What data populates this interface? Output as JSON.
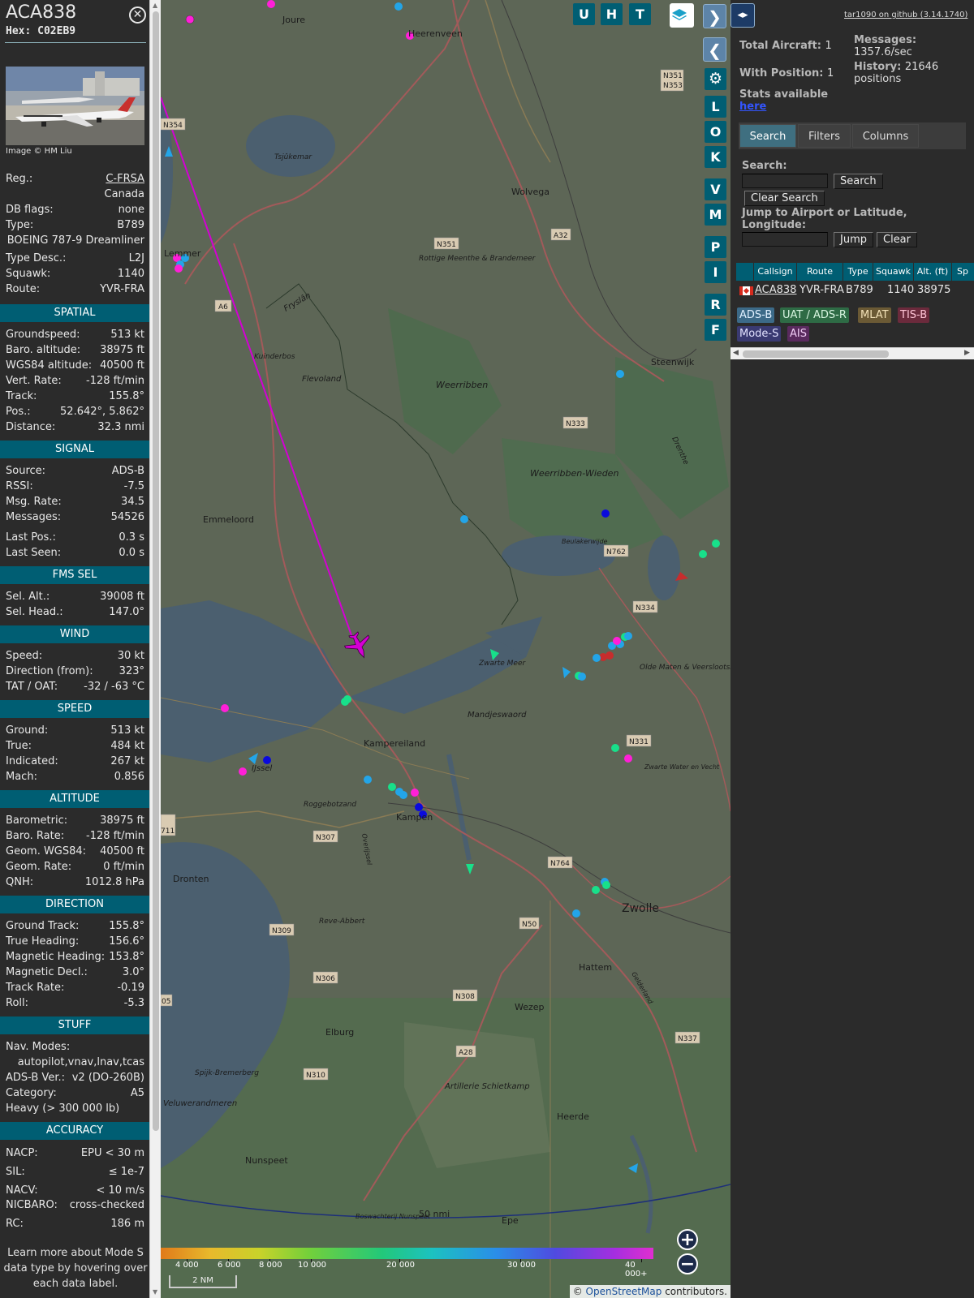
{
  "aircraft": {
    "callsign": "ACA838",
    "hex_label": "Hex:",
    "hex": "C02EB9",
    "photo_credit": "Image © HM Liu",
    "close_icon": "close-icon"
  },
  "info_rows": {
    "reg": {
      "k": "Reg.:",
      "v": "C-FRSA"
    },
    "country": {
      "v": "Canada"
    },
    "dbflags": {
      "k": "DB flags:",
      "v": "none"
    },
    "type": {
      "k": "Type:",
      "v": "B789"
    },
    "type_name": {
      "v": "BOEING 787-9 Dreamliner"
    },
    "type_desc": {
      "k": "Type Desc.:",
      "v": "L2J"
    },
    "squawk": {
      "k": "Squawk:",
      "v": "1140"
    },
    "route": {
      "k": "Route:",
      "v": "YVR-FRA"
    }
  },
  "sections": [
    {
      "title": "SPATIAL",
      "rows": [
        {
          "k": "Groundspeed:",
          "v": "513 kt"
        },
        {
          "k": "Baro. altitude:",
          "v": "38975 ft"
        },
        {
          "k": "WGS84 altitude:",
          "v": "40500 ft"
        },
        {
          "k": "Vert. Rate:",
          "v": "-128 ft/min"
        },
        {
          "k": "Track:",
          "v": "155.8°"
        },
        {
          "k": "Pos.:",
          "v": "52.642°, 5.862°"
        },
        {
          "k": "Distance:",
          "v": "32.3 nmi"
        }
      ]
    },
    {
      "title": "SIGNAL",
      "rows": [
        {
          "k": "Source:",
          "v": "ADS-B"
        },
        {
          "k": "RSSI:",
          "v": "-7.5"
        },
        {
          "k": "Msg. Rate:",
          "v": "34.5"
        },
        {
          "k": "Messages:",
          "v": "54526"
        },
        {
          "k": "Last Pos.:",
          "v": "0.3 s"
        },
        {
          "k": "Last Seen:",
          "v": "0.0 s"
        }
      ]
    },
    {
      "title": "FMS SEL",
      "rows": [
        {
          "k": "Sel. Alt.:",
          "v": "39008 ft"
        },
        {
          "k": "Sel. Head.:",
          "v": "147.0°"
        }
      ]
    },
    {
      "title": "WIND",
      "rows": [
        {
          "k": "Speed:",
          "v": "30 kt"
        },
        {
          "k": "Direction (from):",
          "v": "323°"
        },
        {
          "k": "TAT / OAT:",
          "v": "-32 / -63 °C"
        }
      ]
    },
    {
      "title": "SPEED",
      "rows": [
        {
          "k": "Ground:",
          "v": "513 kt"
        },
        {
          "k": "True:",
          "v": "484 kt"
        },
        {
          "k": "Indicated:",
          "v": "267 kt"
        },
        {
          "k": "Mach:",
          "v": "0.856"
        }
      ]
    },
    {
      "title": "ALTITUDE",
      "rows": [
        {
          "k": "Barometric:",
          "v": "38975 ft"
        },
        {
          "k": "Baro. Rate:",
          "v": "-128 ft/min"
        },
        {
          "k": "Geom. WGS84:",
          "v": "40500 ft"
        },
        {
          "k": "Geom. Rate:",
          "v": "0 ft/min"
        },
        {
          "k": "QNH:",
          "v": "1012.8 hPa"
        }
      ]
    },
    {
      "title": "DIRECTION",
      "rows": [
        {
          "k": "Ground Track:",
          "v": "155.8°"
        },
        {
          "k": "True Heading:",
          "v": "156.6°"
        },
        {
          "k": "Magnetic Heading:",
          "v": "153.8°"
        },
        {
          "k": "Magnetic Decl.:",
          "v": "3.0°"
        },
        {
          "k": "Track Rate:",
          "v": "-0.19"
        },
        {
          "k": "Roll:",
          "v": "-5.3"
        }
      ]
    },
    {
      "title": "STUFF",
      "rows": [
        {
          "k": "Nav. Modes:",
          "v": ""
        },
        {
          "k": "",
          "v": "autopilot,vnav,lnav,tcas"
        },
        {
          "k": "ADS-B Ver.:",
          "v": "v2 (DO-260B)"
        },
        {
          "k": "Category:",
          "v": "A5"
        },
        {
          "k": "Heavy (> 300 000 lb)",
          "v": ""
        }
      ]
    },
    {
      "title": "ACCURACY",
      "rows": [
        {
          "k": "NACP:",
          "v": "EPU < 30 m"
        },
        {
          "k": "SIL:",
          "v": "≤ 1e-7"
        },
        {
          "k": "NACV:",
          "v": "< 10 m/s"
        },
        {
          "k": "NICBARO:",
          "v": "cross-checked"
        },
        {
          "k": "RC:",
          "v": "186 m"
        }
      ]
    }
  ],
  "footer_note": "Learn more about Mode S data type by hovering over each data label.",
  "map": {
    "buttons": [
      "U",
      "H",
      "T"
    ],
    "side_buttons": [
      "L",
      "O",
      "K",
      "V",
      "M",
      "P",
      "I",
      "R",
      "F"
    ],
    "places": [
      {
        "name": "Joure"
      },
      {
        "name": "Heerenveen"
      },
      {
        "name": "Wolvega"
      },
      {
        "name": "Lemmer"
      },
      {
        "name": "Tsjûkemar"
      },
      {
        "name": "Rottige Meenthe & Brandemeer"
      },
      {
        "name": "Fryslân"
      },
      {
        "name": "Kuinderbos"
      },
      {
        "name": "Flevoland"
      },
      {
        "name": "Weerribben"
      },
      {
        "name": "Steenwijk"
      },
      {
        "name": "Weerribben-Wieden"
      },
      {
        "name": "Emmeloord"
      },
      {
        "name": "Beulakerwijde"
      },
      {
        "name": "Drenthe"
      },
      {
        "name": "Zwarte Meer"
      },
      {
        "name": "Olde Maten & Veerslootslanden"
      },
      {
        "name": "Mandjeswaord"
      },
      {
        "name": "Kampereiland"
      },
      {
        "name": "Kampen"
      },
      {
        "name": "Dronten"
      },
      {
        "name": "Roggebotzand"
      },
      {
        "name": "Zwolle"
      },
      {
        "name": "Reve-Abbert"
      },
      {
        "name": "Hattem"
      },
      {
        "name": "Wezep"
      },
      {
        "name": "Elburg"
      },
      {
        "name": "Artillerie Schietkamp"
      },
      {
        "name": "Heerde"
      },
      {
        "name": "Spijk-Bremerberg"
      },
      {
        "name": "Veluwerandmeren"
      },
      {
        "name": "Nunspeet"
      },
      {
        "name": "Epe"
      },
      {
        "name": "Boswachterij Nunspeet"
      },
      {
        "name": "IJssel"
      },
      {
        "name": "Overijssel"
      },
      {
        "name": "Gelderland"
      },
      {
        "name": "Zwarte Water en Vecht"
      }
    ],
    "roads": [
      "N354",
      "N351",
      "N353",
      "A6",
      "A32",
      "N351",
      "N333",
      "N762",
      "N334",
      "N331",
      "N307",
      "N764",
      "N309",
      "N50",
      "N306",
      "N308",
      "A28",
      "N310",
      "N337",
      "711",
      "05"
    ],
    "range_ring_label": "50 nmi",
    "scale_label": "2 NM",
    "altitude_scale": [
      "4 000",
      "6 000",
      "8 000",
      "10 000",
      "20 000",
      "30 000",
      "40 000+"
    ],
    "attribution_prefix": "© ",
    "attribution_link": "OpenStreetMap",
    "attribution_suffix": " contributors.",
    "zoom_in": "+",
    "zoom_out": "−"
  },
  "right_panel": {
    "toggle_icon": "expand-icon",
    "github_link": "tar1090 on github (3.14.1740)",
    "total_aircraft_label": "Total Aircraft:",
    "total_aircraft": "1",
    "with_position_label": "With Position:",
    "with_position": "1",
    "messages_label": "Messages:",
    "messages_rate": "1357.6/sec",
    "history_label": "History:",
    "history_value": "21646 positions",
    "stats_label": "Stats available",
    "stats_link": "here",
    "tabs": [
      "Search",
      "Filters",
      "Columns"
    ],
    "search_label": "Search:",
    "search_button": "Search",
    "clear_search_button": "Clear Search",
    "jump_label": "Jump to Airport or Latitude, Longitude:",
    "jump_button": "Jump",
    "clear_button": "Clear",
    "table": {
      "headers": [
        "Callsign",
        "Route",
        "Type",
        "Squawk",
        "Alt. (ft)",
        "Sp"
      ],
      "rows": [
        {
          "callsign": "ACA838",
          "route": "YVR-FRA",
          "type": "B789",
          "squawk": "1140",
          "alt": "38975"
        }
      ]
    },
    "source_chips": [
      {
        "label": "ADS-B",
        "color": "#3c6a88",
        "text": "#e0f0ff"
      },
      {
        "label": "UAT / ADS-R",
        "color": "#2e6b45",
        "text": "#d8f5e0"
      },
      {
        "label": "MLAT",
        "color": "#6b5a35",
        "text": "#f3e2b8"
      },
      {
        "label": "TIS-B",
        "color": "#6b2a3c",
        "text": "#ffc4d6"
      },
      {
        "label": "Mode-S",
        "color": "#3a3a72",
        "text": "#e2e2ff"
      },
      {
        "label": "AIS",
        "color": "#5a2a5e",
        "text": "#f1cdf6"
      }
    ]
  }
}
